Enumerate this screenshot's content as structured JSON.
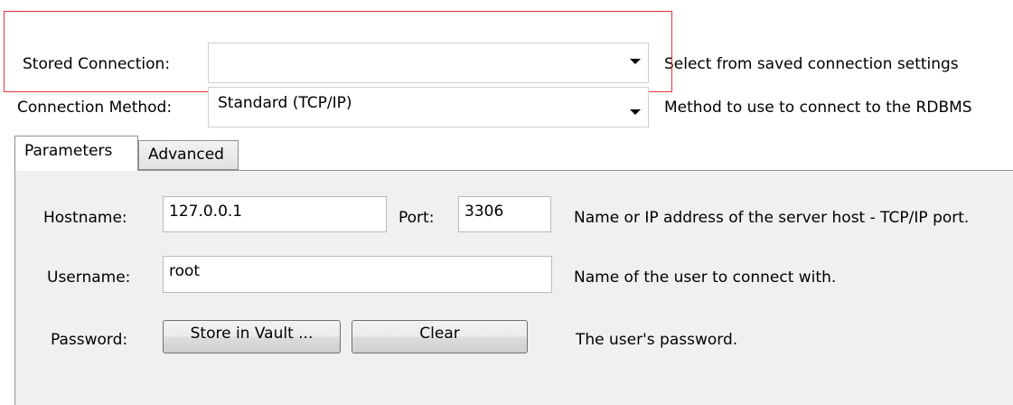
{
  "stored_connection": {
    "label": "Stored Connection:",
    "value": "",
    "hint": "Select from saved connection settings"
  },
  "connection_method": {
    "label": "Connection Method:",
    "value": "Standard (TCP/IP)",
    "hint": "Method to use to connect to the RDBMS"
  },
  "tabs": [
    {
      "label": "Parameters",
      "active": true
    },
    {
      "label": "Advanced",
      "active": false
    }
  ],
  "parameters": {
    "hostname": {
      "label": "Hostname:",
      "value": "127.0.0.1",
      "hint": "Name or IP address of the server host - TCP/IP port."
    },
    "port": {
      "label": "Port:",
      "value": "3306"
    },
    "username": {
      "label": "Username:",
      "value": "root",
      "hint": "Name of the user to connect with."
    },
    "password": {
      "label": "Password:",
      "store_button": "Store in Vault ...",
      "clear_button": "Clear",
      "hint": "The user's password."
    }
  },
  "colors": {
    "highlight_border": "#e8333a",
    "panel_background": "#f0f0f0"
  }
}
